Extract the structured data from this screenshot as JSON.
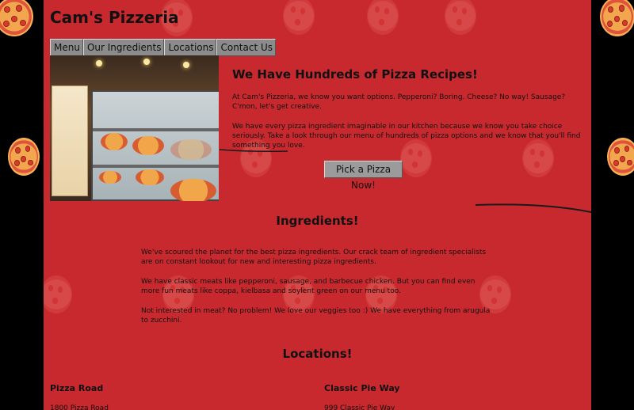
{
  "site": {
    "title": "Cam's Pizzeria"
  },
  "nav": {
    "items": [
      "Menu",
      "Our Ingredients",
      "Locations",
      "Contact Us"
    ]
  },
  "hero": {
    "heading": "We Have Hundreds of Pizza Recipes!",
    "p1": "At Cam's Pizzeria, we know you want options. Pepperoni? Boring. Cheese? No way! Sausage? C'mon, let's get creative.",
    "p2": "We have every pizza ingredient imaginable in our kitchen because we know you take choice seriously. Take a look through our menu of hundreds of pizza options and we know that you'll find something you love.",
    "button": "Pick a Pizza Now!"
  },
  "ingredients": {
    "heading": "Ingredients!",
    "p1": "We've scoured the planet for the best pizza ingredients. Our crack team of ingredient specialists are on constant lookout for new and interesting pizza ingredients.",
    "p2": "We have classic meats like pepperoni, sausage, and barbecue chicken. But you can find even more fun meats like coppa, kielbasa and soylent green on our menu too.",
    "p3": "Not interested in meat? No problem! We love our veggies too :) We have everything from arugula to zucchini."
  },
  "locations": {
    "heading": "Locations!",
    "items": [
      {
        "name": "Pizza Road",
        "address": "1800 Pizza Road"
      },
      {
        "name": "Classic Pie Way",
        "address": "999 Classic Pie Way"
      }
    ]
  },
  "colors": {
    "page_bg": "#c8292e",
    "gutter": "#000000",
    "button": "#8b8b8b"
  }
}
